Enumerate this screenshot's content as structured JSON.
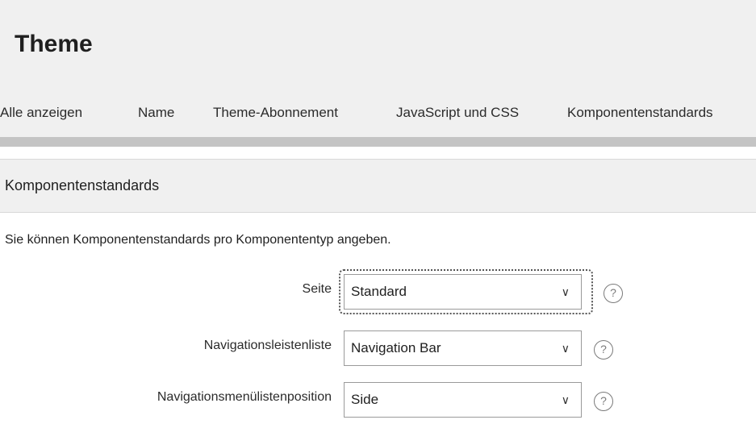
{
  "header": {
    "title": "Theme",
    "tabs": [
      {
        "label": "Alle anzeigen"
      },
      {
        "label": "Name"
      },
      {
        "label": "Theme-Abonnement"
      },
      {
        "label": "JavaScript und CSS"
      },
      {
        "label": "Komponentenstandards",
        "active": true
      }
    ]
  },
  "section": {
    "title": "Komponentenstandards",
    "description": "Sie können Komponentenstandards pro Komponententyp angeben."
  },
  "fields": [
    {
      "label": "Seite",
      "value": "Standard",
      "help": "?"
    },
    {
      "label": "Navigationsleistenliste",
      "value": "Navigation Bar",
      "help": "?"
    },
    {
      "label": "Navigationsmenülistenposition",
      "value": "Side",
      "help": "?"
    }
  ],
  "icons": {
    "chevron": "chevron-down-icon",
    "help": "help-icon"
  },
  "colors": {
    "header_bg": "#f0f0f0",
    "tab_bar": "#c4c4c4",
    "active_tab_underline": "#555555"
  }
}
